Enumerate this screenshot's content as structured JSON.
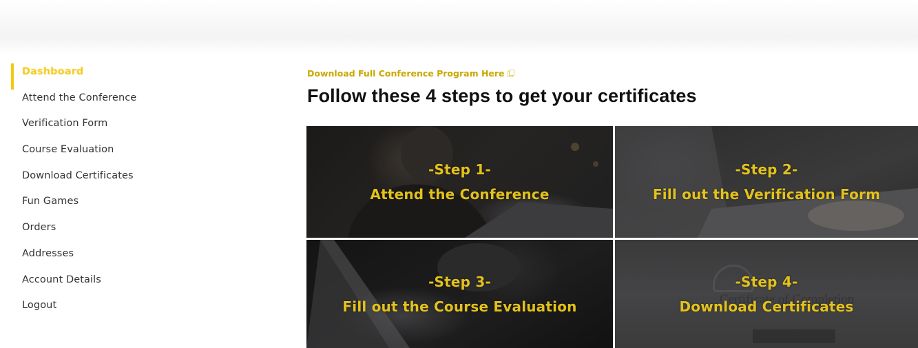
{
  "sidebar": {
    "items": [
      {
        "label": "Dashboard",
        "active": true
      },
      {
        "label": "Attend the Conference"
      },
      {
        "label": "Verification Form"
      },
      {
        "label": "Course Evaluation"
      },
      {
        "label": "Download Certificates"
      },
      {
        "label": "Fun Games"
      },
      {
        "label": "Orders"
      },
      {
        "label": "Addresses"
      },
      {
        "label": "Account Details"
      },
      {
        "label": "Logout"
      }
    ]
  },
  "main": {
    "download_link": "Download Full Conference Program Here",
    "title": "Follow these 4 steps to get your certificates",
    "steps": [
      {
        "label": "-Step 1-",
        "text": "Attend the Conference"
      },
      {
        "label": "-Step 2-",
        "text": "Fill out the Verification Form"
      },
      {
        "label": "-Step 3-",
        "text": "Fill out the Course Evaluation"
      },
      {
        "label": "-Step 4-",
        "text": "Download Certificates"
      }
    ],
    "certificate_image_text": "Certificate of Completion"
  },
  "colors": {
    "accent": "#f2c811",
    "step_text": "#e3c21b",
    "link": "#c9a800"
  }
}
